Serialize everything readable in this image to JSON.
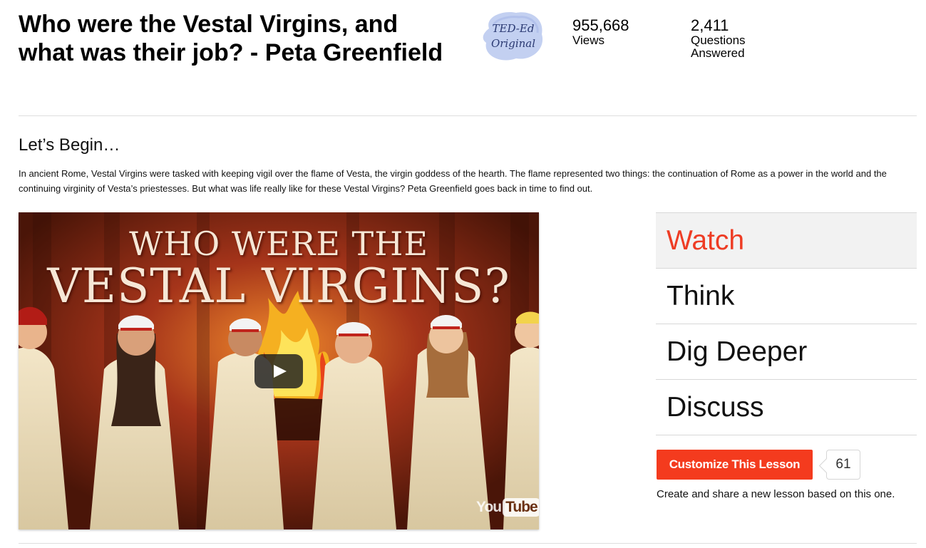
{
  "lesson": {
    "title": "Who were the Vestal Virgins, and what was their job? - Peta Greenfield",
    "badge_text_line1": "TED-Ed",
    "badge_text_line2": "Original",
    "stats": {
      "views_count": "955,668",
      "views_label": "Views",
      "answered_count": "2,411",
      "answered_label_line1": "Questions",
      "answered_label_line2": "Answered"
    }
  },
  "intro": {
    "heading": "Let’s Begin…",
    "description": "In ancient Rome, Vestal Virgins were tasked with keeping vigil over the flame of Vesta, the virgin goddess of the hearth. The flame represented two things: the continuation of Rome as a power in the world and the continuing virginity of Vesta’s priestesses. But what was life really like for these Vestal Virgins? Peta Greenfield goes back in time to find out."
  },
  "video": {
    "title_line1": "WHO WERE THE",
    "title_line2": "VESTAL VIRGINS?",
    "logo_you": "You",
    "logo_tube": "Tube",
    "play_icon": "play-icon"
  },
  "nav": {
    "items": [
      {
        "label": "Watch",
        "active": true
      },
      {
        "label": "Think",
        "active": false
      },
      {
        "label": "Dig Deeper",
        "active": false
      },
      {
        "label": "Discuss",
        "active": false
      }
    ]
  },
  "customize": {
    "button_label": "Customize This Lesson",
    "count": "61",
    "note": "Create and share a new lesson based on this one."
  },
  "colors": {
    "accent": "#f43b1e",
    "active_nav_text": "#ee3c24",
    "badge_blue": "#b9c8ee"
  }
}
